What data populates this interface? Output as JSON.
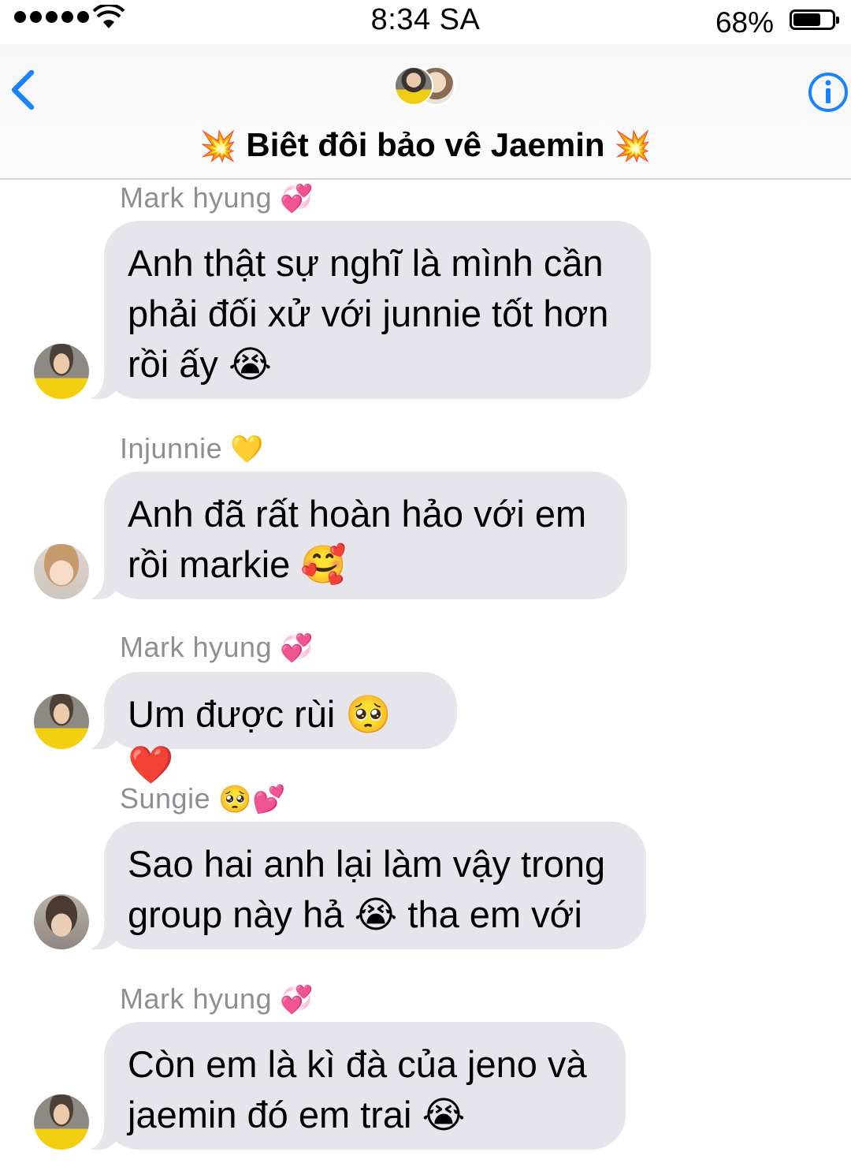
{
  "status_bar": {
    "time": "8:34 SA",
    "battery_percent": "68%",
    "battery_level": 0.68,
    "signal_dots": 5
  },
  "header": {
    "title_emoji_left": "💥",
    "title": "Biêt đôi bảo vê Jaemin",
    "title_emoji_right": "💥",
    "back_icon": "chevron-left-icon",
    "info_icon": "info-icon",
    "accent_color": "#1a82fb"
  },
  "messages": [
    {
      "sender": "Mark hyung",
      "sender_emoji": "💞",
      "text": "Anh thật sự nghĩ là mình cần\nphải đối xử với junnie tốt hơn\nrồi ấy 😭",
      "avatar": "mark"
    },
    {
      "sender": "Injunnie",
      "sender_emoji": "💛",
      "text": "Anh đã rất hoàn hảo với em\nrồi markie 🥰",
      "avatar": "jun"
    },
    {
      "sender": "Mark hyung",
      "sender_emoji": "💞",
      "text": "Um được rùi 🥺❤️",
      "avatar": "mark"
    },
    {
      "sender": "Sungie",
      "sender_emoji": "🥺💕",
      "text": "Sao hai anh lại làm vậy trong\ngroup này hả 😭 tha em với",
      "avatar": "sung"
    },
    {
      "sender": "Mark hyung",
      "sender_emoji": "💞",
      "text": "Còn em là kì đà của jeno và\njaemin đó em trai 😭",
      "avatar": "mark"
    }
  ],
  "colors": {
    "bubble": "#e6e5eb",
    "sender_name": "#8e8e93"
  }
}
